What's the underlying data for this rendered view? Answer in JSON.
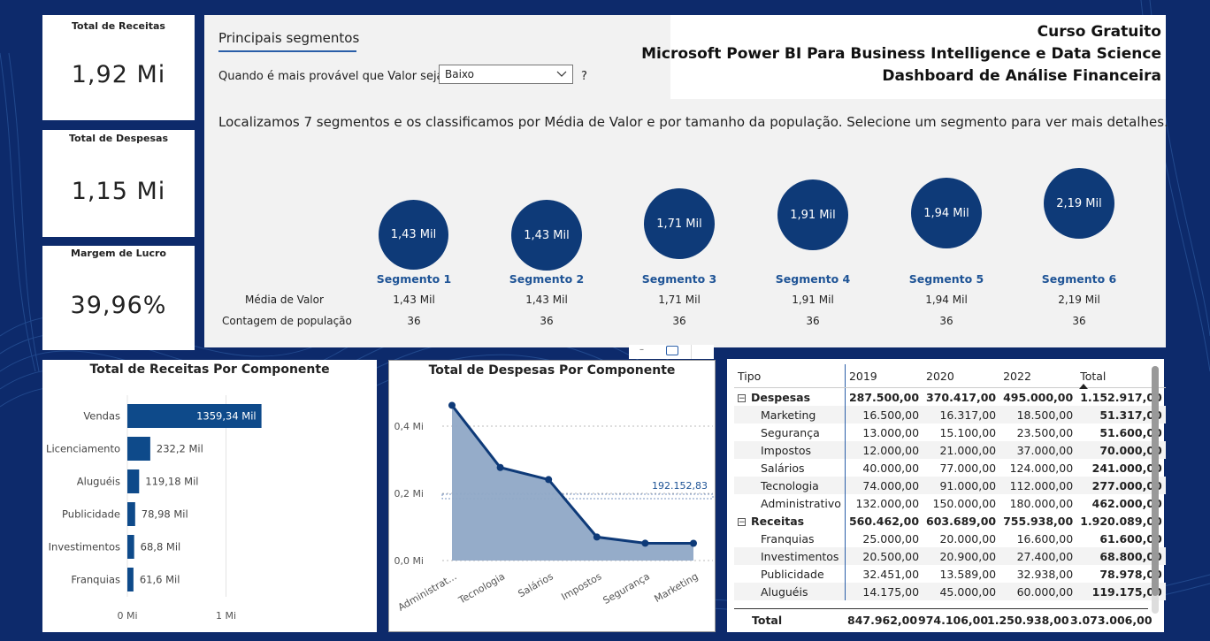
{
  "kpis": [
    {
      "title": "Total de Receitas",
      "value": "1,92 Mi"
    },
    {
      "title": "Total de Despesas",
      "value": "1,15 Mi"
    },
    {
      "title": "Margem de Lucro",
      "value": "39,96%"
    }
  ],
  "header": {
    "line1": "Curso Gratuito",
    "line2": "Microsoft Power BI Para Business Intelligence e Data Science",
    "line3": "Dashboard de Análise Financeira"
  },
  "segments_panel": {
    "tab_label": "Principais segmentos",
    "question": "Quando é mais provável que Valor seja",
    "selected_option": "Baixo",
    "question_mark": "?",
    "description": "Localizamos 7 segmentos e os classificamos por Média de Valor e por tamanho da população. Selecione um segmento para ver mais detalhes.",
    "row_label_avg": "Média de Valor",
    "row_label_count": "Contagem de população",
    "segments": [
      {
        "name": "Segmento 1",
        "bubble": "1,43 Mil",
        "avg": "1,43 Mil",
        "count": "36"
      },
      {
        "name": "Segmento 2",
        "bubble": "1,43 Mil",
        "avg": "1,43 Mil",
        "count": "36"
      },
      {
        "name": "Segmento 3",
        "bubble": "1,71 Mil",
        "avg": "1,71 Mil",
        "count": "36"
      },
      {
        "name": "Segmento 4",
        "bubble": "1,91 Mil",
        "avg": "1,91 Mil",
        "count": "36"
      },
      {
        "name": "Segmento 5",
        "bubble": "1,94 Mil",
        "avg": "1,94 Mil",
        "count": "36"
      },
      {
        "name": "Segmento 6",
        "bubble": "2,19 Mil",
        "avg": "2,19 Mil",
        "count": "36"
      }
    ]
  },
  "chart_data": [
    {
      "type": "bar",
      "title": "Total de Receitas Por Componente",
      "categories": [
        "Vendas",
        "Licenciamento",
        "Aluguéis",
        "Publicidade",
        "Investimentos",
        "Franquias"
      ],
      "values": [
        1359.34,
        232.2,
        119.18,
        78.98,
        68.8,
        61.6
      ],
      "value_labels": [
        "1359,34 Mil",
        "232,2 Mil",
        "119,18 Mil",
        "78,98 Mil",
        "68,8 Mil",
        "61,6 Mil"
      ],
      "unit": "Mil",
      "x_ticks": [
        "0 Mi",
        "1 Mi"
      ],
      "xlim": [
        0,
        2600
      ],
      "color": "#0e4a8a"
    },
    {
      "type": "area",
      "title": "Total de Despesas Por Componente",
      "categories": [
        "Administrat...",
        "Tecnologia",
        "Salários",
        "Impostos",
        "Segurança",
        "Marketing"
      ],
      "values": [
        462000,
        277000,
        241000,
        70000,
        51600,
        51317
      ],
      "y_ticks": [
        "0,0 Mi",
        "0,2 Mi",
        "0,4 Mi"
      ],
      "ylim": [
        0,
        500000
      ],
      "reference_value": 192152.83,
      "reference_label": "192.152,83",
      "line_color": "#0e3a78",
      "fill_color": "#8fa8c6"
    }
  ],
  "matrix": {
    "headers": [
      "Tipo",
      "2019",
      "2020",
      "2022",
      "Total"
    ],
    "rows": [
      {
        "label": "Despesas",
        "group": true,
        "v": [
          "287.500,00",
          "370.417,00",
          "495.000,00",
          "1.152.917,00"
        ]
      },
      {
        "label": "Marketing",
        "group": false,
        "v": [
          "16.500,00",
          "16.317,00",
          "18.500,00",
          "51.317,00"
        ]
      },
      {
        "label": "Segurança",
        "group": false,
        "v": [
          "13.000,00",
          "15.100,00",
          "23.500,00",
          "51.600,00"
        ]
      },
      {
        "label": "Impostos",
        "group": false,
        "v": [
          "12.000,00",
          "21.000,00",
          "37.000,00",
          "70.000,00"
        ]
      },
      {
        "label": "Salários",
        "group": false,
        "v": [
          "40.000,00",
          "77.000,00",
          "124.000,00",
          "241.000,00"
        ]
      },
      {
        "label": "Tecnologia",
        "group": false,
        "v": [
          "74.000,00",
          "91.000,00",
          "112.000,00",
          "277.000,00"
        ]
      },
      {
        "label": "Administrativo",
        "group": false,
        "v": [
          "132.000,00",
          "150.000,00",
          "180.000,00",
          "462.000,00"
        ]
      },
      {
        "label": "Receitas",
        "group": true,
        "v": [
          "560.462,00",
          "603.689,00",
          "755.938,00",
          "1.920.089,00"
        ]
      },
      {
        "label": "Franquias",
        "group": false,
        "v": [
          "25.000,00",
          "20.000,00",
          "16.600,00",
          "61.600,00"
        ]
      },
      {
        "label": "Investimentos",
        "group": false,
        "v": [
          "20.500,00",
          "20.900,00",
          "27.400,00",
          "68.800,00"
        ]
      },
      {
        "label": "Publicidade",
        "group": false,
        "v": [
          "32.451,00",
          "13.589,00",
          "32.938,00",
          "78.978,00"
        ]
      },
      {
        "label": "Aluguéis",
        "group": false,
        "v": [
          "14.175,00",
          "45.000,00",
          "60.000,00",
          "119.175,00"
        ]
      }
    ],
    "total": {
      "label": "Total",
      "v": [
        "847.962,00",
        "974.106,00",
        "1.250.938,00",
        "3.073.006,00"
      ]
    }
  }
}
